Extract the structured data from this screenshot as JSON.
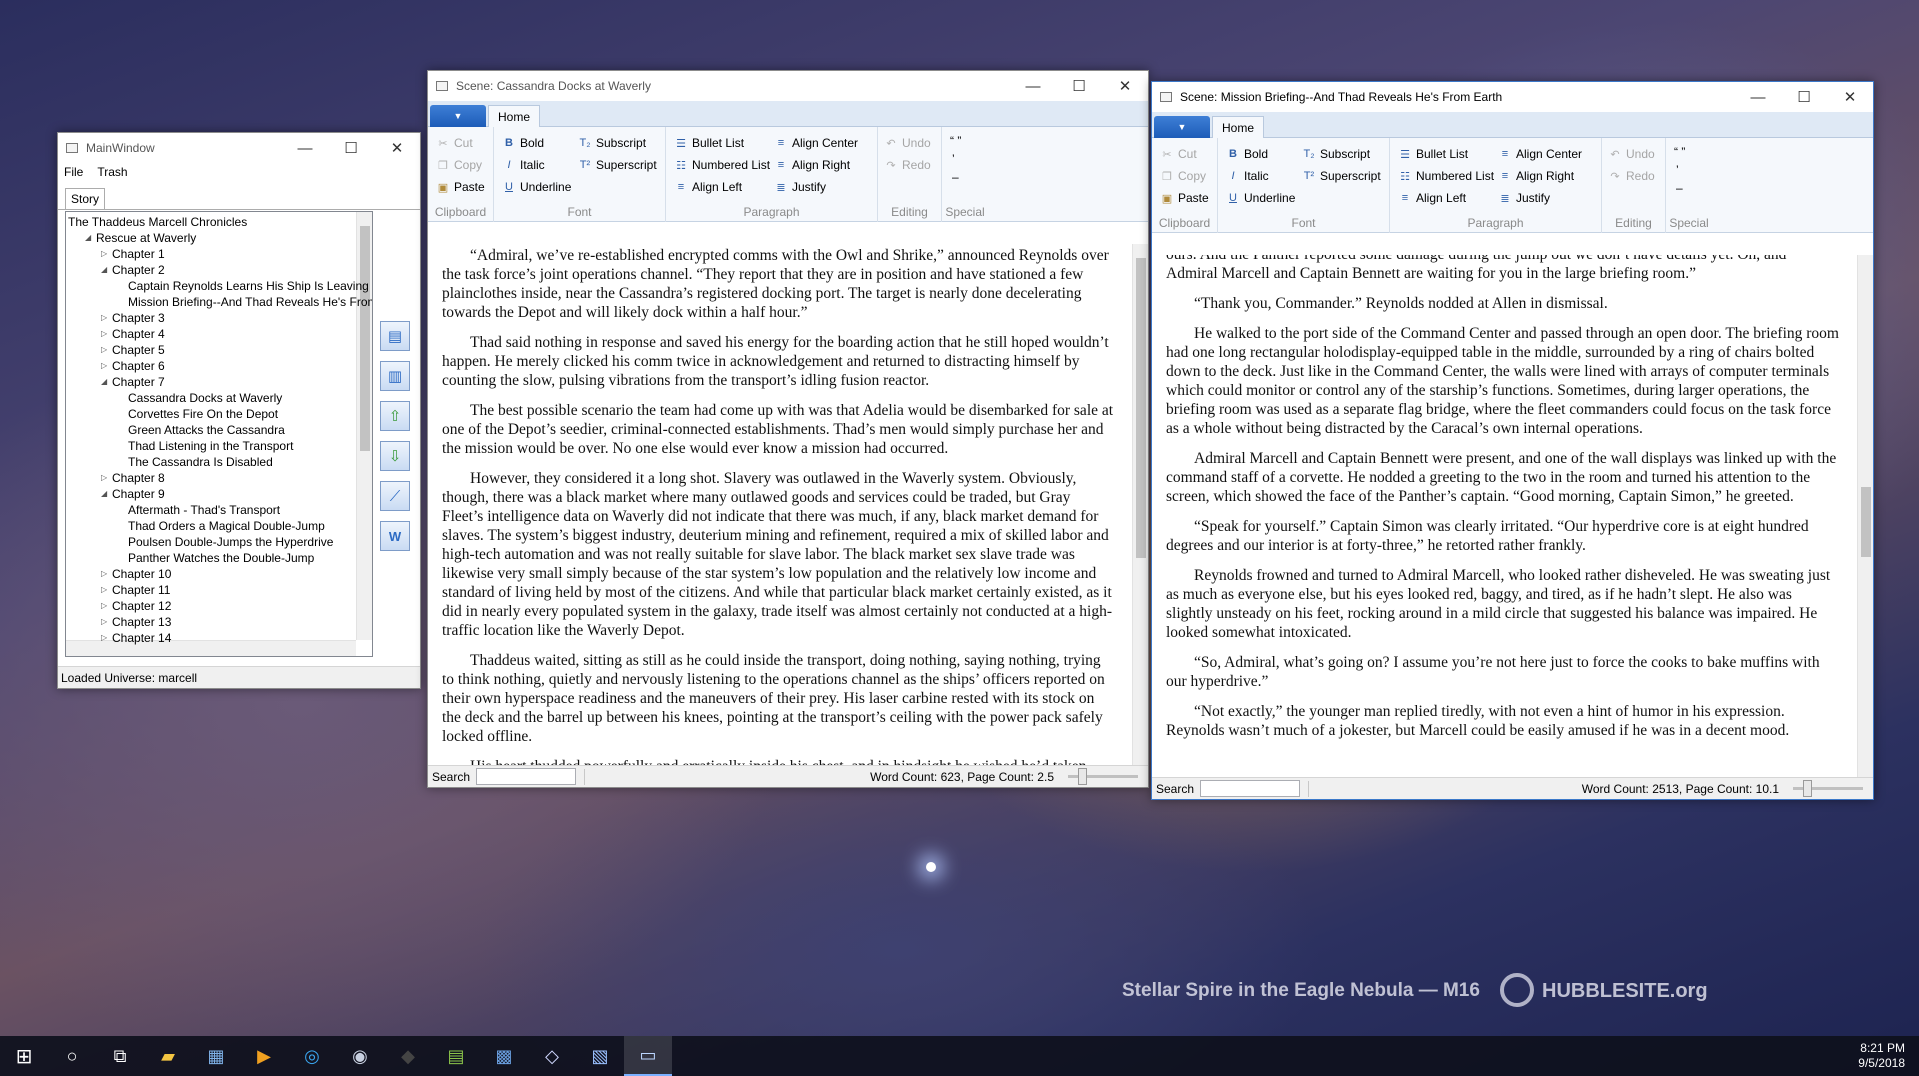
{
  "desktop": {
    "caption": "Stellar Spire in the Eagle Nebula — M16",
    "hubble": "HUBBLESITE.org"
  },
  "main_window": {
    "title": "MainWindow",
    "menu": [
      "File",
      "Trash"
    ],
    "tab": "Story",
    "tree": [
      {
        "label": "The Thaddeus Marcell Chronicles",
        "level": 0,
        "exp": ""
      },
      {
        "label": "Rescue at Waverly",
        "level": 1,
        "exp": "◢"
      },
      {
        "label": "Chapter 1",
        "level": 2,
        "exp": "▷"
      },
      {
        "label": "Chapter 2",
        "level": 2,
        "exp": "◢"
      },
      {
        "label": "Captain Reynolds Learns His Ship Is Leaving",
        "level": 3,
        "exp": ""
      },
      {
        "label": "Mission Briefing--And Thad Reveals He's From Earth",
        "level": 3,
        "exp": ""
      },
      {
        "label": "Chapter 3",
        "level": 2,
        "exp": "▷"
      },
      {
        "label": "Chapter 4",
        "level": 2,
        "exp": "▷"
      },
      {
        "label": "Chapter 5",
        "level": 2,
        "exp": "▷"
      },
      {
        "label": "Chapter 6",
        "level": 2,
        "exp": "▷"
      },
      {
        "label": "Chapter 7",
        "level": 2,
        "exp": "◢"
      },
      {
        "label": "Cassandra Docks at Waverly",
        "level": 3,
        "exp": ""
      },
      {
        "label": "Corvettes Fire On the Depot",
        "level": 3,
        "exp": ""
      },
      {
        "label": "Green Attacks the Cassandra",
        "level": 3,
        "exp": ""
      },
      {
        "label": "Thad Listening in the Transport",
        "level": 3,
        "exp": ""
      },
      {
        "label": "The Cassandra Is Disabled",
        "level": 3,
        "exp": ""
      },
      {
        "label": "Chapter 8",
        "level": 2,
        "exp": "▷"
      },
      {
        "label": "Chapter 9",
        "level": 2,
        "exp": "◢"
      },
      {
        "label": "Aftermath - Thad's Transport",
        "level": 3,
        "exp": ""
      },
      {
        "label": "Thad Orders a Magical Double-Jump",
        "level": 3,
        "exp": ""
      },
      {
        "label": "Poulsen Double-Jumps the Hyperdrive",
        "level": 3,
        "exp": ""
      },
      {
        "label": "Panther Watches the Double-Jump",
        "level": 3,
        "exp": ""
      },
      {
        "label": "Chapter 10",
        "level": 2,
        "exp": "▷"
      },
      {
        "label": "Chapter 11",
        "level": 2,
        "exp": "▷"
      },
      {
        "label": "Chapter 12",
        "level": 2,
        "exp": "▷"
      },
      {
        "label": "Chapter 13",
        "level": 2,
        "exp": "▷"
      },
      {
        "label": "Chapter 14",
        "level": 2,
        "exp": "▷"
      }
    ],
    "status": "Loaded Universe: marcell"
  },
  "ribbon": {
    "home_tab": "Home",
    "clipboard": {
      "label": "Clipboard",
      "cut": "Cut",
      "copy": "Copy",
      "paste": "Paste"
    },
    "font": {
      "label": "Font",
      "bold": "Bold",
      "italic": "Italic",
      "underline": "Underline",
      "subscript": "Subscript",
      "superscript": "Superscript"
    },
    "paragraph": {
      "label": "Paragraph",
      "bullet": "Bullet List",
      "numbered": "Numbered List",
      "align_left": "Align Left",
      "align_center": "Align Center",
      "align_right": "Align Right",
      "justify": "Justify"
    },
    "editing": {
      "label": "Editing",
      "undo": "Undo",
      "redo": "Redo"
    },
    "special": {
      "label": "Special"
    }
  },
  "scene1": {
    "title": "Scene: Cassandra Docks at Waverly",
    "search_label": "Search",
    "word_count": "Word Count: 623, Page Count: 2.5",
    "paragraphs": [
      "“Admiral, we’ve re-established encrypted comms with the Owl and Shrike,” announced Reynolds over the task force’s joint operations channel. “They report that they are in position and have stationed a few plainclothes inside, near the Cassandra’s registered docking port. The target is nearly done decelerating towards the Depot and will likely dock within a half hour.”",
      "Thad said nothing in response and saved his energy for the boarding action that he still hoped wouldn’t happen. He merely clicked his comm twice in acknowledgement and returned to distracting himself by counting the slow, pulsing vibrations from the transport’s idling fusion reactor.",
      "The best possible scenario the team had come up with was that Adelia would be disembarked for sale at one of the Depot’s seedier, criminal-connected establishments. Thad’s men would simply purchase her and the mission would be over. No one else would ever know a mission had occurred.",
      "However, they considered it a long shot. Slavery was outlawed in the Waverly system. Obviously, though, there was a black market where many outlawed goods and services could be traded, but Gray Fleet’s intelligence data on Waverly did not indicate that there was much, if any, black market demand for slaves. The system’s biggest industry, deuterium mining and refinement, required a mix of skilled labor and high-tech automation and was not really suitable for slave labor. The black market sex slave trade was likewise very small simply because of the star system’s low population and the relatively low income and standard of living held by most of the citizens. And while that particular black market certainly existed, as it did in nearly every populated system in the galaxy, trade itself was almost certainly not conducted at a high-traffic location like the Waverly Depot.",
      "Thaddeus waited, sitting as still as he could inside the transport, doing nothing, saying nothing, trying to think nothing, quietly and nervously listening to the operations channel as the ships’ officers reported on their own hyperspace readiness and the maneuvers of their prey. His laser carbine rested with its stock on the deck and the barrel up between his knees, pointing at the transport’s ceiling with the power pack safely locked offline.",
      "His heart thudded powerfully and erratically inside his chest, and in hindsight he wished he’d taken"
    ]
  },
  "scene2": {
    "title": "Scene: Mission Briefing--And Thad Reveals He's From Earth",
    "search_label": "Search",
    "word_count": "Word Count: 2513, Page Count: 10.1",
    "paragraphs": [
      "ours. And the Panther reported some damage during the jump out we don’t have details yet. Oh, and Admiral Marcell and Captain Bennett are waiting for you in the large briefing room.”",
      "“Thank you, Commander.” Reynolds nodded at Allen in dismissal.",
      "He walked to the port side of the Command Center and passed through an open door. The briefing room had one long rectangular holodisplay-equipped table in the middle, surrounded by a ring of chairs bolted down to the deck. Just like in the Command Center, the walls were lined with arrays of computer terminals which could monitor or control any of the starship’s functions. Sometimes, during larger operations, the briefing room was used as a separate flag bridge, where the fleet commanders could focus on the task force as a whole without being distracted by the Caracal’s own internal operations.",
      "Admiral Marcell and Captain Bennett were present, and one of the wall displays was linked up with the command staff of a corvette. He nodded a greeting to the two in the room and turned his attention to the screen, which showed the face of the Panther’s captain. “Good morning, Captain Simon,” he greeted.",
      "“Speak for yourself.” Captain Simon was clearly irritated. “Our hyperdrive core is at eight hundred degrees and our interior is at forty-three,” he retorted rather frankly.",
      "Reynolds frowned and turned to Admiral Marcell, who looked rather disheveled. He was sweating just as much as everyone else, but his eyes looked red, baggy, and tired, as if he hadn’t slept. He also was slightly unsteady on his feet, rocking around in a mild circle that suggested his balance was impaired. He looked somewhat intoxicated.",
      "“So, Admiral, what’s going on? I assume you’re not here just to force the cooks to bake muffins with our hyperdrive.”",
      "“Not exactly,” the younger man replied tiredly, with not even a hint of humor in his expression. Reynolds wasn’t much of a jokester, but Marcell could be easily amused if he was in a decent mood."
    ]
  },
  "taskbar": {
    "time": "8:21 PM",
    "date": "9/5/2018"
  }
}
